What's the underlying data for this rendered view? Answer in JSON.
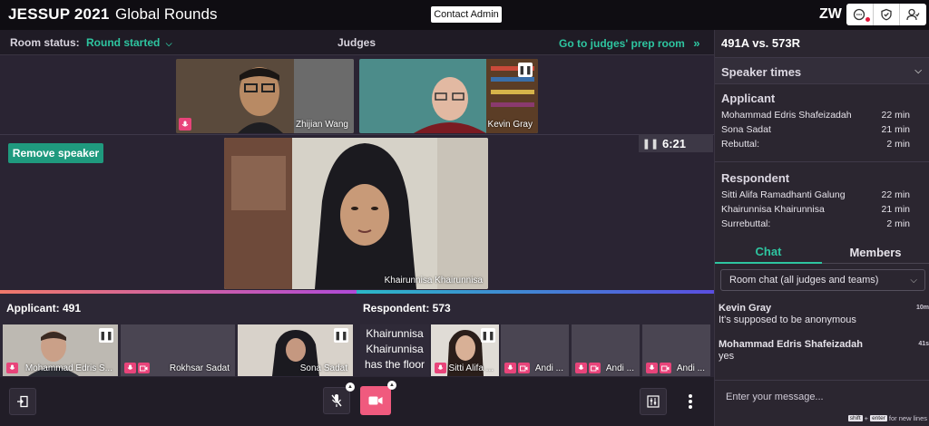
{
  "header": {
    "app_title": "JESSUP 2021",
    "event_name": "Global Rounds",
    "contact_label": "Contact Admin",
    "user_initials": "ZW"
  },
  "subbar": {
    "room_status_label": "Room status:",
    "room_status_value": "Round started",
    "judges_heading": "Judges",
    "prep_room_link": "Go to judges' prep room"
  },
  "judges": [
    {
      "name": "Zhijian Wang"
    },
    {
      "name": "Kevin Gray"
    }
  ],
  "stage": {
    "remove_speaker_label": "Remove speaker",
    "timer_value": "6:21",
    "main_speaker_name": "Khairunnisa Khairunnisa"
  },
  "applicant": {
    "heading": "Applicant: 491",
    "participants": [
      {
        "name": "Mohammad Edris S..."
      },
      {
        "name": "Rokhsar Sadat"
      },
      {
        "name": "Sona Sadat"
      }
    ]
  },
  "respondent": {
    "heading": "Respondent: 573",
    "floor_text": [
      "Khairunnisa",
      "Khairunnisa",
      "has the floor"
    ],
    "participants": [
      {
        "name": "Sitti Alifa ..."
      },
      {
        "name": "Andi ..."
      },
      {
        "name": "Andi ..."
      },
      {
        "name": "Andi ..."
      }
    ]
  },
  "sidebar": {
    "match": "491A vs. 573R",
    "speaker_times_heading": "Speaker times",
    "applicant_heading": "Applicant",
    "applicant_times": [
      {
        "name": "Mohammad Edris Shafeizadah",
        "time": "22 min"
      },
      {
        "name": "Sona Sadat",
        "time": "21 min"
      },
      {
        "name": "Rebuttal:",
        "time": "2 min"
      }
    ],
    "respondent_heading": "Respondent",
    "respondent_times": [
      {
        "name": "Sitti Alifa Ramadhanti Galung",
        "time": "22 min"
      },
      {
        "name": "Khairunnisa Khairunnisa",
        "time": "21 min"
      },
      {
        "name": "Surrebuttal:",
        "time": "2 min"
      }
    ],
    "tab_chat": "Chat",
    "tab_members": "Members",
    "room_select": "Room chat (all judges and teams)",
    "messages": [
      {
        "author": "Kevin Gray",
        "text": "It's supposed to be anonymous",
        "time": "10m"
      },
      {
        "author": "Mohammad Edris Shafeizadah",
        "text": "yes",
        "time": "41s"
      }
    ],
    "input_placeholder": "Enter your message...",
    "hint_key1": "shift",
    "hint_plus": "+",
    "hint_key2": "enter",
    "hint_text": "for new lines"
  },
  "colors": {
    "accent": "#2ec5a0",
    "mic_badge": "#e8447a",
    "camera_button": "#f05a7e",
    "applicant_line": "#e85fa0",
    "respondent_line": "#4a7be0"
  }
}
